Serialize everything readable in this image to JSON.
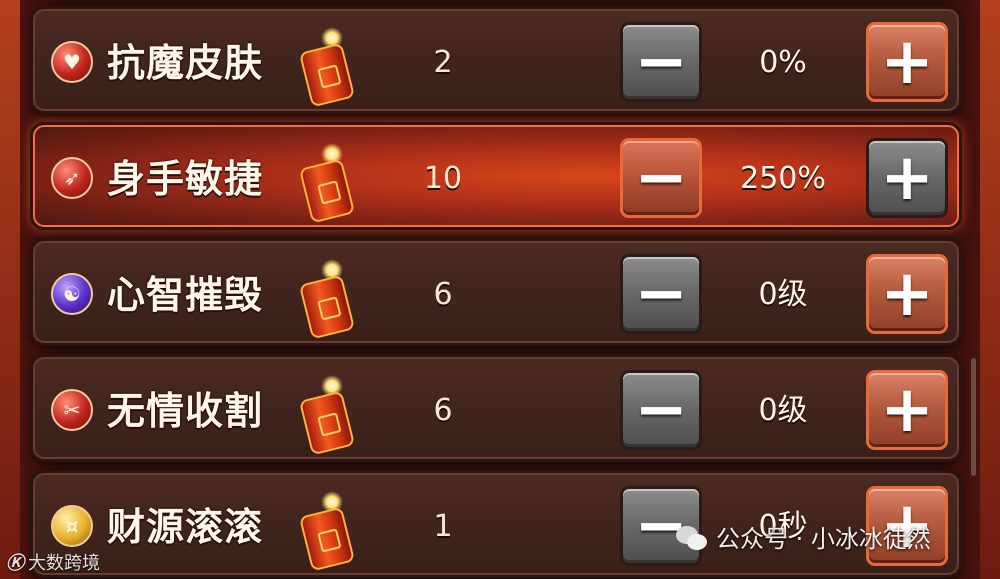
{
  "skills": [
    {
      "name": "抗魔皮肤",
      "count": "2",
      "value": "0%",
      "icon": "shield-icon",
      "minus": "−",
      "plus": "+"
    },
    {
      "name": "身手敏捷",
      "count": "10",
      "value": "250%",
      "icon": "agility-icon",
      "minus": "−",
      "plus": "+"
    },
    {
      "name": "心智摧毁",
      "count": "6",
      "value": "0级",
      "icon": "mind-icon",
      "minus": "−",
      "plus": "+"
    },
    {
      "name": "无情收割",
      "count": "6",
      "value": "0级",
      "icon": "harvest-icon",
      "minus": "−",
      "plus": "+"
    },
    {
      "name": "财源滚滚",
      "count": "1",
      "value": "0秒",
      "icon": "gold-ingot-icon",
      "minus": "−",
      "plus": "+"
    }
  ],
  "watermarks": {
    "left_logo": "Ⓚ",
    "left_text": "大数跨境",
    "right_text": "公众号 · 小冰冰徒然"
  }
}
